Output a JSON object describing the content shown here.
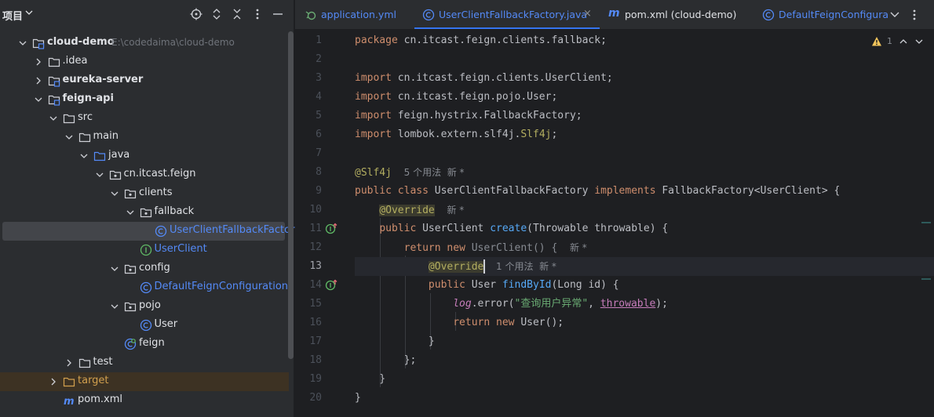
{
  "panel": {
    "title": "项目",
    "tree": [
      {
        "label": "cloud-demo",
        "path": "E:\\codedaima\\cloud-demo",
        "indent": 0,
        "arrow": "down",
        "icon": "module",
        "bold": true
      },
      {
        "label": ".idea",
        "indent": 1,
        "arrow": "right",
        "icon": "folder"
      },
      {
        "label": "eureka-server",
        "indent": 1,
        "arrow": "right",
        "icon": "module",
        "bold": true
      },
      {
        "label": "feign-api",
        "indent": 1,
        "arrow": "down",
        "icon": "module",
        "bold": true
      },
      {
        "label": "src",
        "indent": 2,
        "arrow": "down",
        "icon": "folder"
      },
      {
        "label": "main",
        "indent": 3,
        "arrow": "down",
        "icon": "folder"
      },
      {
        "label": "java",
        "indent": 4,
        "arrow": "down",
        "icon": "src-folder"
      },
      {
        "label": "cn.itcast.feign",
        "indent": 5,
        "arrow": "down",
        "icon": "package"
      },
      {
        "label": "clients",
        "indent": 6,
        "arrow": "down",
        "icon": "package"
      },
      {
        "label": "fallback",
        "indent": 7,
        "arrow": "down",
        "icon": "package"
      },
      {
        "label": "UserClientFallbackFactory",
        "indent": 8,
        "arrow": "none",
        "icon": "class",
        "selected": true,
        "color": "#548af7"
      },
      {
        "label": "UserClient",
        "indent": 7,
        "arrow": "none",
        "icon": "interface",
        "color": "#548af7"
      },
      {
        "label": "config",
        "indent": 6,
        "arrow": "down",
        "icon": "package"
      },
      {
        "label": "DefaultFeignConfiguration",
        "indent": 7,
        "arrow": "none",
        "icon": "class",
        "color": "#548af7"
      },
      {
        "label": "pojo",
        "indent": 6,
        "arrow": "down",
        "icon": "package"
      },
      {
        "label": "User",
        "indent": 7,
        "arrow": "none",
        "icon": "class"
      },
      {
        "label": "feign",
        "indent": 6,
        "arrow": "none",
        "icon": "config-class"
      },
      {
        "label": "test",
        "indent": 3,
        "arrow": "right",
        "icon": "folder"
      },
      {
        "label": "target",
        "indent": 2,
        "arrow": "right",
        "icon": "excluded-folder",
        "excluded": true,
        "color": "#d2a04e"
      },
      {
        "label": "pom.xml",
        "indent": 2,
        "arrow": "none",
        "icon": "maven"
      }
    ]
  },
  "tabs": [
    {
      "label": "application.yml",
      "icon": "yaml",
      "active": false
    },
    {
      "label": "UserClientFallbackFactory.java",
      "icon": "class",
      "active": true,
      "close": "×"
    },
    {
      "label": "pom.xml (cloud-demo)",
      "icon": "maven",
      "active": false
    },
    {
      "label": "DefaultFeignConfigura",
      "icon": "class",
      "active": false
    }
  ],
  "editor": {
    "inspection_count": "1",
    "current_line": 13,
    "line_numbers": [
      "1",
      "2",
      "3",
      "4",
      "5",
      "6",
      "7",
      "8",
      "9",
      "10",
      "11",
      "12",
      "13",
      "14",
      "15",
      "16",
      "17",
      "18",
      "19",
      "20"
    ],
    "lines": [
      [
        {
          "t": "package ",
          "c": "kw"
        },
        {
          "t": "cn.itcast.feign.clients.fallback;"
        }
      ],
      [],
      [
        {
          "t": "import ",
          "c": "kw"
        },
        {
          "t": "cn.itcast.feign.clients.UserClient;"
        }
      ],
      [
        {
          "t": "import ",
          "c": "kw"
        },
        {
          "t": "cn.itcast.feign.pojo.User;"
        }
      ],
      [
        {
          "t": "import ",
          "c": "kw"
        },
        {
          "t": "feign.hystrix.FallbackFactory;"
        }
      ],
      [
        {
          "t": "import ",
          "c": "kw"
        },
        {
          "t": "lombok.extern.slf4j."
        },
        {
          "t": "Slf4j",
          "c": "ann"
        },
        {
          "t": ";"
        }
      ],
      [],
      [
        {
          "t": "@Slf4j",
          "c": "ann"
        },
        {
          "t": "  "
        },
        {
          "t": "5 个用法  新 *",
          "c": "hint"
        }
      ],
      [
        {
          "t": "public class ",
          "c": "kw"
        },
        {
          "t": "UserClientFallbackFactory "
        },
        {
          "t": "implements ",
          "c": "kw"
        },
        {
          "t": "FallbackFactory<UserClient> {"
        }
      ],
      [
        {
          "t": "    "
        },
        {
          "t": "@Override",
          "c": "ann hl-ann"
        },
        {
          "t": "  "
        },
        {
          "t": "新 *",
          "c": "hint"
        }
      ],
      [
        {
          "t": "    "
        },
        {
          "t": "public ",
          "c": "kw"
        },
        {
          "t": "UserClient "
        },
        {
          "t": "create",
          "c": "fn"
        },
        {
          "t": "(Throwable throwable) {"
        }
      ],
      [
        {
          "t": "        "
        },
        {
          "t": "return new ",
          "c": "kw"
        },
        {
          "t": "UserClient() {",
          "c": "dim"
        },
        {
          "t": "  "
        },
        {
          "t": "新 *",
          "c": "hint"
        }
      ],
      [
        {
          "t": "            "
        },
        {
          "t": "@Override",
          "c": "ann hl-ann"
        },
        {
          "t": "  "
        },
        {
          "t": "1 个用法  新 *",
          "c": "hint"
        }
      ],
      [
        {
          "t": "            "
        },
        {
          "t": "public ",
          "c": "kw"
        },
        {
          "t": "User "
        },
        {
          "t": "findById",
          "c": "fn"
        },
        {
          "t": "(Long id) {"
        }
      ],
      [
        {
          "t": "                "
        },
        {
          "t": "log",
          "c": "ital"
        },
        {
          "t": ".error("
        },
        {
          "t": "\"查询用户异常\"",
          "c": "str"
        },
        {
          "t": ", "
        },
        {
          "t": "throwable",
          "c": "underl"
        },
        {
          "t": ");"
        }
      ],
      [
        {
          "t": "                "
        },
        {
          "t": "return new ",
          "c": "kw"
        },
        {
          "t": "User();"
        }
      ],
      [
        {
          "t": "            }"
        }
      ],
      [
        {
          "t": "        };"
        }
      ],
      [
        {
          "t": "    }"
        }
      ],
      [
        {
          "t": "}"
        }
      ]
    ]
  },
  "colors": {
    "accent": "#3574f0",
    "keyword": "#cf8e6d",
    "annotation": "#b3ae60",
    "function": "#56a8f5",
    "string": "#6aab73"
  }
}
